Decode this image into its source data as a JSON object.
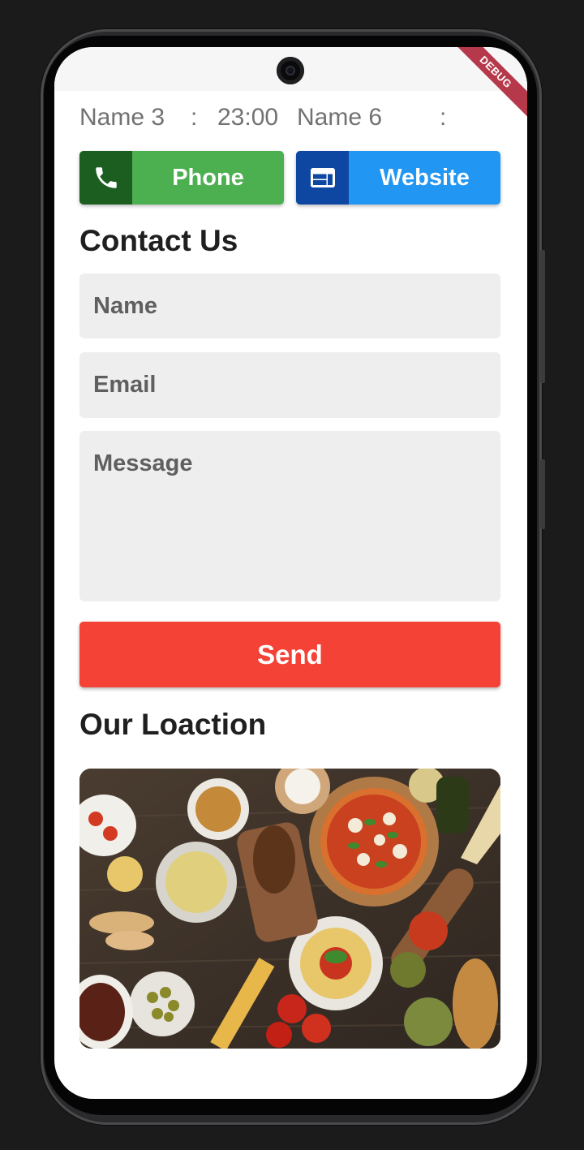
{
  "debug_banner": "DEBUG",
  "hours": {
    "name_left": "Name 3",
    "sep_left": ":",
    "time": "23:00",
    "name_right": "Name 6",
    "sep_right": ":"
  },
  "actions": {
    "phone_label": "Phone",
    "website_label": "Website"
  },
  "contact": {
    "title": "Contact Us",
    "name_placeholder": "Name",
    "email_placeholder": "Email",
    "message_placeholder": "Message",
    "send_label": "Send"
  },
  "location": {
    "title": "Our Loaction"
  },
  "icons": {
    "phone": "phone-icon",
    "website": "web-icon"
  },
  "colors": {
    "phone_button": "#4caf50",
    "phone_icon_bg": "#1b5e20",
    "website_button": "#2196f3",
    "website_icon_bg": "#0d47a1",
    "send_button": "#f44336",
    "input_bg": "#eeeeee",
    "debug_ribbon": "#b5394b"
  }
}
